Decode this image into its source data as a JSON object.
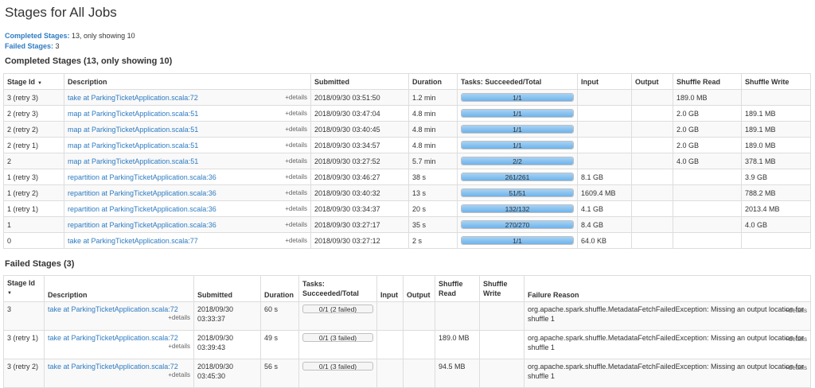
{
  "page_title": "Stages for All Jobs",
  "summary": {
    "completed_label": "Completed Stages:",
    "completed_value": "13, only showing 10",
    "failed_label": "Failed Stages:",
    "failed_value": "3"
  },
  "completed": {
    "heading": "Completed Stages (13, only showing 10)",
    "columns": [
      "Stage Id",
      "Description",
      "Submitted",
      "Duration",
      "Tasks: Succeeded/Total",
      "Input",
      "Output",
      "Shuffle Read",
      "Shuffle Write"
    ],
    "sort_indicator": "▼",
    "details_label": "+details",
    "rows": [
      {
        "stage": "3 (retry 3)",
        "desc": "take at ParkingTicketApplication.scala:72",
        "submitted": "2018/09/30 03:51:50",
        "duration": "1.2 min",
        "tasks": "1/1",
        "progress": 1.0,
        "input": "",
        "output": "",
        "shuffle_read": "189.0 MB",
        "shuffle_write": ""
      },
      {
        "stage": "2 (retry 3)",
        "desc": "map at ParkingTicketApplication.scala:51",
        "submitted": "2018/09/30 03:47:04",
        "duration": "4.8 min",
        "tasks": "1/1",
        "progress": 1.0,
        "input": "",
        "output": "",
        "shuffle_read": "2.0 GB",
        "shuffle_write": "189.1 MB"
      },
      {
        "stage": "2 (retry 2)",
        "desc": "map at ParkingTicketApplication.scala:51",
        "submitted": "2018/09/30 03:40:45",
        "duration": "4.8 min",
        "tasks": "1/1",
        "progress": 1.0,
        "input": "",
        "output": "",
        "shuffle_read": "2.0 GB",
        "shuffle_write": "189.1 MB"
      },
      {
        "stage": "2 (retry 1)",
        "desc": "map at ParkingTicketApplication.scala:51",
        "submitted": "2018/09/30 03:34:57",
        "duration": "4.8 min",
        "tasks": "1/1",
        "progress": 1.0,
        "input": "",
        "output": "",
        "shuffle_read": "2.0 GB",
        "shuffle_write": "189.0 MB"
      },
      {
        "stage": "2",
        "desc": "map at ParkingTicketApplication.scala:51",
        "submitted": "2018/09/30 03:27:52",
        "duration": "5.7 min",
        "tasks": "2/2",
        "progress": 1.0,
        "input": "",
        "output": "",
        "shuffle_read": "4.0 GB",
        "shuffle_write": "378.1 MB"
      },
      {
        "stage": "1 (retry 3)",
        "desc": "repartition at ParkingTicketApplication.scala:36",
        "submitted": "2018/09/30 03:46:27",
        "duration": "38 s",
        "tasks": "261/261",
        "progress": 1.0,
        "input": "8.1 GB",
        "output": "",
        "shuffle_read": "",
        "shuffle_write": "3.9 GB"
      },
      {
        "stage": "1 (retry 2)",
        "desc": "repartition at ParkingTicketApplication.scala:36",
        "submitted": "2018/09/30 03:40:32",
        "duration": "13 s",
        "tasks": "51/51",
        "progress": 1.0,
        "input": "1609.4 MB",
        "output": "",
        "shuffle_read": "",
        "shuffle_write": "788.2 MB"
      },
      {
        "stage": "1 (retry 1)",
        "desc": "repartition at ParkingTicketApplication.scala:36",
        "submitted": "2018/09/30 03:34:37",
        "duration": "20 s",
        "tasks": "132/132",
        "progress": 1.0,
        "input": "4.1 GB",
        "output": "",
        "shuffle_read": "",
        "shuffle_write": "2013.4 MB"
      },
      {
        "stage": "1",
        "desc": "repartition at ParkingTicketApplication.scala:36",
        "submitted": "2018/09/30 03:27:17",
        "duration": "35 s",
        "tasks": "270/270",
        "progress": 1.0,
        "input": "8.4 GB",
        "output": "",
        "shuffle_read": "",
        "shuffle_write": "4.0 GB"
      },
      {
        "stage": "0",
        "desc": "take at ParkingTicketApplication.scala:77",
        "submitted": "2018/09/30 03:27:12",
        "duration": "2 s",
        "tasks": "1/1",
        "progress": 1.0,
        "input": "64.0 KB",
        "output": "",
        "shuffle_read": "",
        "shuffle_write": ""
      }
    ]
  },
  "failed": {
    "heading": "Failed Stages (3)",
    "columns": {
      "stage": "Stage Id",
      "desc": "Description",
      "submitted": "Submitted",
      "duration": "Duration",
      "tasks_1": "Tasks:",
      "tasks_2": "Succeeded/Total",
      "input": "Input",
      "output": "Output",
      "shuffle_read_1": "Shuffle",
      "shuffle_read_2": "Read",
      "shuffle_write_1": "Shuffle",
      "shuffle_write_2": "Write",
      "reason": "Failure Reason"
    },
    "sort_indicator": "▼",
    "details_label": "+details",
    "rows": [
      {
        "stage": "3",
        "desc": "take at ParkingTicketApplication.scala:72",
        "submitted_date": "2018/09/30",
        "submitted_time": "03:33:37",
        "duration": "60 s",
        "tasks": "0/1 (2 failed)",
        "progress": 0.0,
        "input": "",
        "output": "",
        "shuffle_read": "",
        "shuffle_write": "",
        "reason": "org.apache.spark.shuffle.MetadataFetchFailedException: Missing an output location for shuffle 1"
      },
      {
        "stage": "3 (retry 1)",
        "desc": "take at ParkingTicketApplication.scala:72",
        "submitted_date": "2018/09/30",
        "submitted_time": "03:39:43",
        "duration": "49 s",
        "tasks": "0/1 (3 failed)",
        "progress": 0.0,
        "input": "",
        "output": "",
        "shuffle_read": "189.0 MB",
        "shuffle_write": "",
        "reason": "org.apache.spark.shuffle.MetadataFetchFailedException: Missing an output location for shuffle 1"
      },
      {
        "stage": "3 (retry 2)",
        "desc": "take at ParkingTicketApplication.scala:72",
        "submitted_date": "2018/09/30",
        "submitted_time": "03:45:30",
        "duration": "56 s",
        "tasks": "0/1 (3 failed)",
        "progress": 0.0,
        "input": "",
        "output": "",
        "shuffle_read": "94.5 MB",
        "shuffle_write": "",
        "reason": "org.apache.spark.shuffle.MetadataFetchFailedException: Missing an output location for shuffle 1"
      }
    ]
  },
  "colors": {
    "link": "#2e7bc1",
    "progress_fill": "#6fb3ea",
    "border": "#dddddd"
  }
}
